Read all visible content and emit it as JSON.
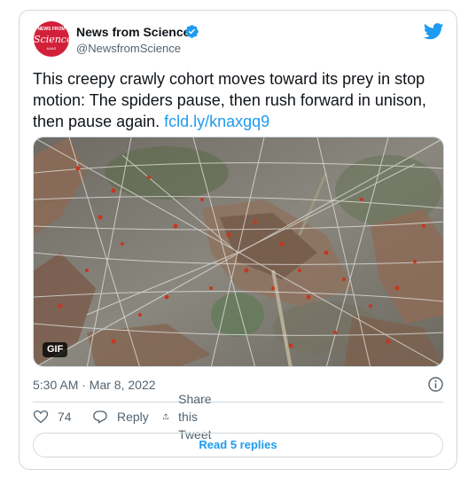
{
  "account": {
    "avatar_line1": "NEWS FROM",
    "avatar_line2": "Science",
    "avatar_line3": "AAAS",
    "name": "News from Science",
    "handle": "@NewsfromScience",
    "verified": true,
    "verified_icon": "verified-badge-icon",
    "avatar_color": "#d3203a"
  },
  "platform_icon": "twitter-bird-icon",
  "tweet": {
    "text": "This creepy crawly cohort moves toward its prey in stop motion: The spiders pause, then rush forward in unison, then pause again. ",
    "link": "fcld.ly/knaxgq9",
    "timestamp": "5:30 AM · Mar 8, 2022"
  },
  "media": {
    "badge": "GIF"
  },
  "actions": {
    "likes_count": "74",
    "reply_label": "Reply",
    "share_label": "Share this Tweet",
    "read_replies_label": "Read 5 replies"
  },
  "colors": {
    "accent": "#1d9bf0",
    "like": "#536471",
    "border": "#cfd9de"
  }
}
